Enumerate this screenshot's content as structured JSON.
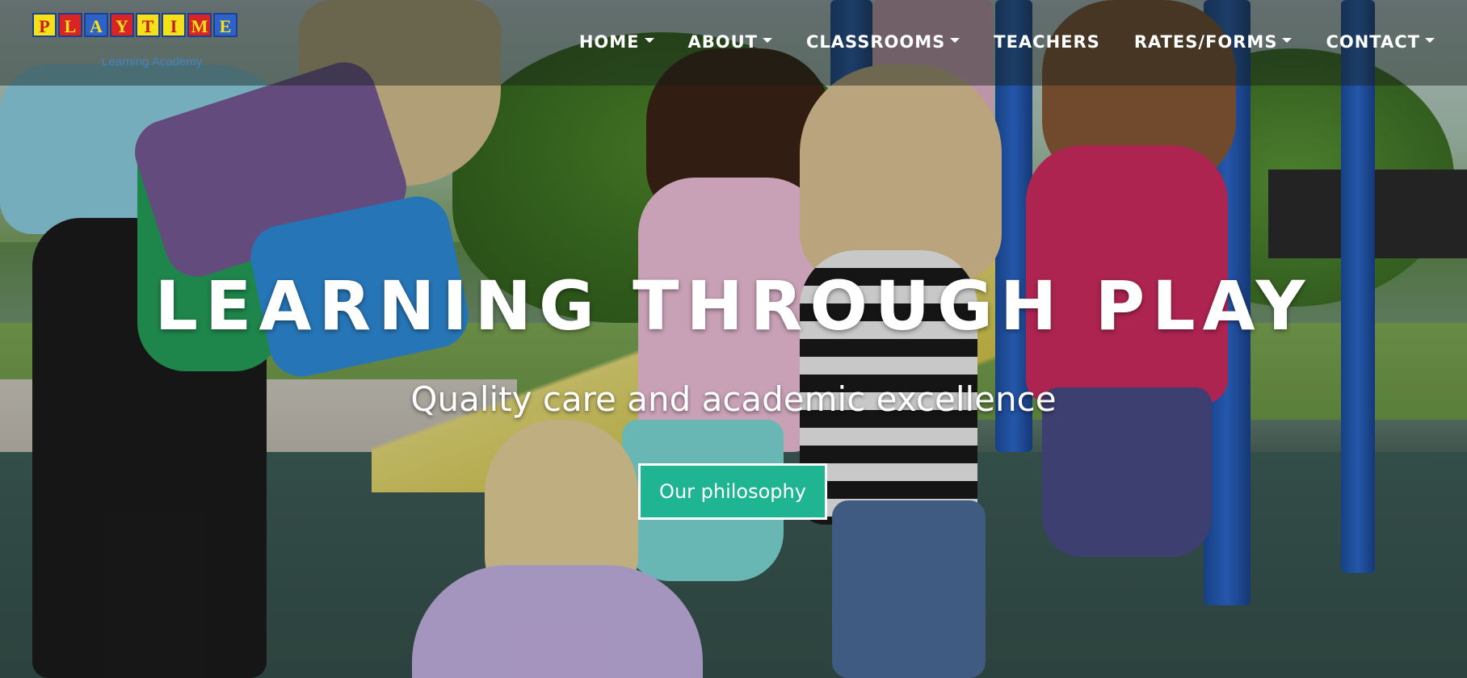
{
  "logo": {
    "letters": [
      "P",
      "L",
      "A",
      "Y",
      "T",
      "I",
      "M",
      "E"
    ],
    "subtitle": "Learning Academy",
    "colors": {
      "yellow": "#f5e11a",
      "red": "#d82424",
      "blue": "#2d62c9"
    }
  },
  "nav": {
    "items": [
      {
        "label": "HOME",
        "dropdown": true
      },
      {
        "label": "ABOUT",
        "dropdown": true
      },
      {
        "label": "CLASSROOMS",
        "dropdown": true
      },
      {
        "label": "TEACHERS",
        "dropdown": false
      },
      {
        "label": "RATES/FORMS",
        "dropdown": true
      },
      {
        "label": "CONTACT",
        "dropdown": true
      }
    ]
  },
  "hero": {
    "title": "LEARNING THROUGH PLAY",
    "subtitle": "Quality care and academic excellence",
    "cta_label": "Our philosophy",
    "cta_color": "#1fb592"
  }
}
